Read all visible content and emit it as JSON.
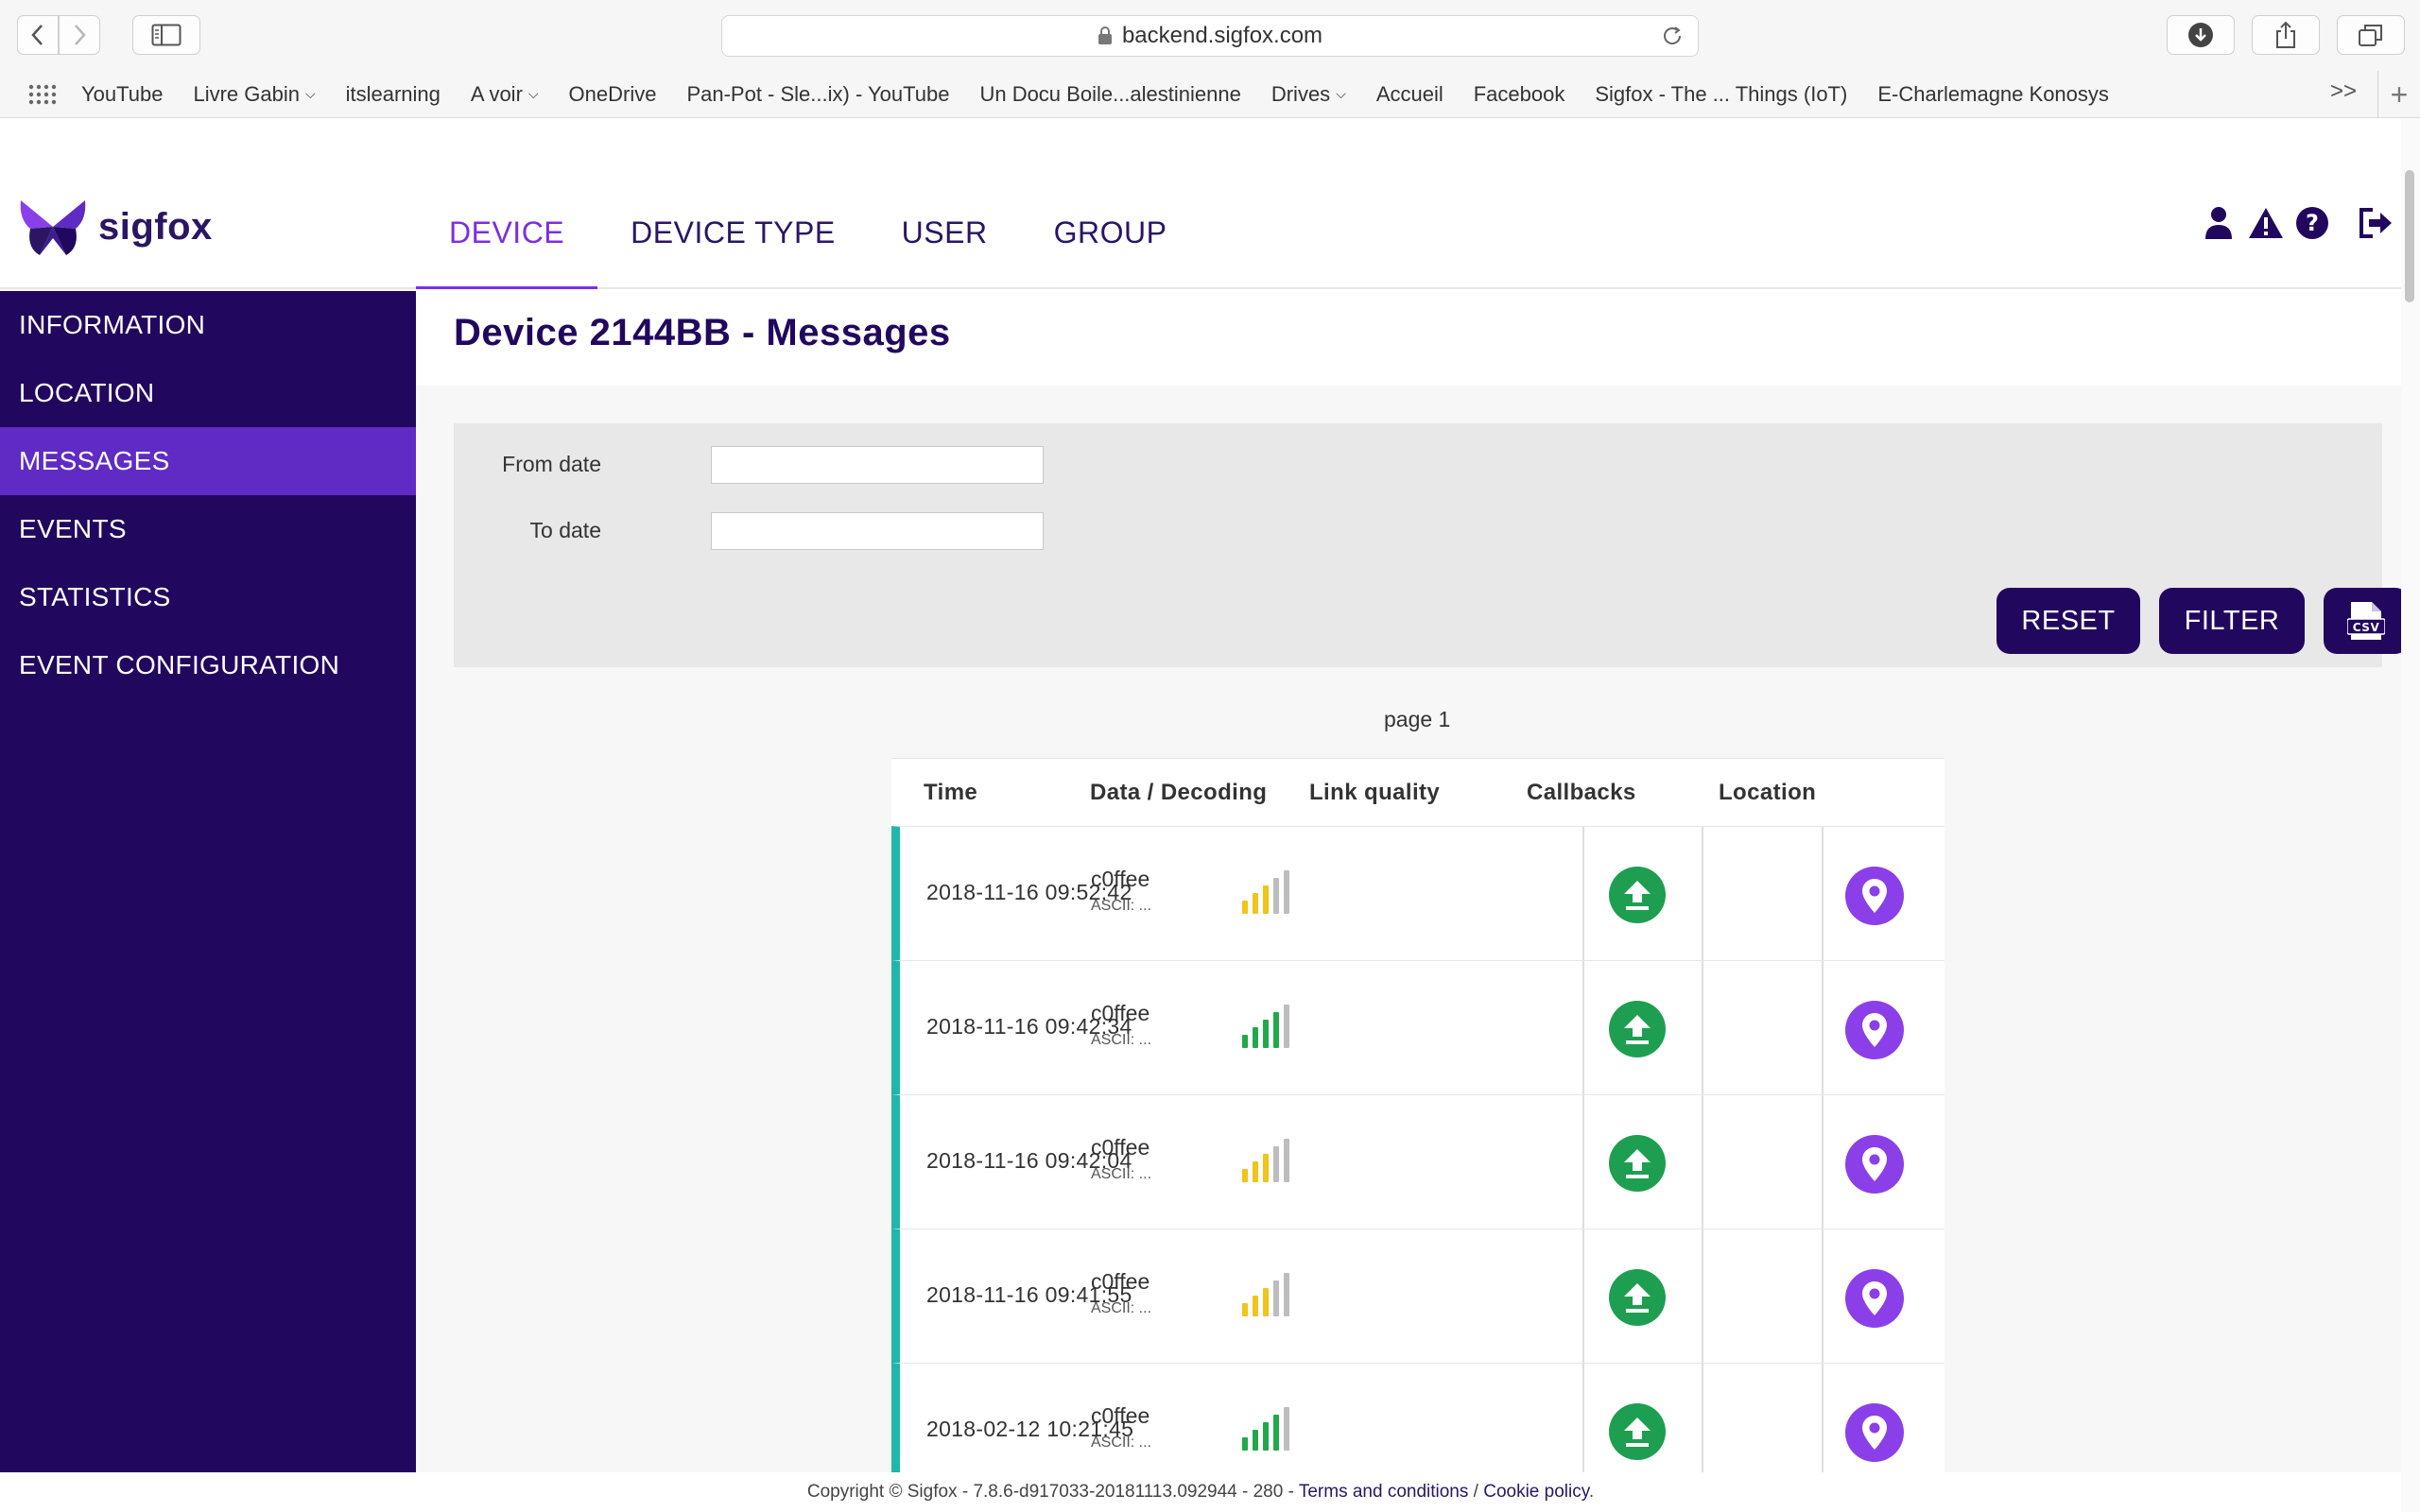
{
  "browser": {
    "url": "backend.sigfox.com",
    "bookmarks": [
      {
        "label": "YouTube",
        "dropdown": false
      },
      {
        "label": "Livre Gabin",
        "dropdown": true
      },
      {
        "label": "itslearning",
        "dropdown": false
      },
      {
        "label": "A voir",
        "dropdown": true
      },
      {
        "label": "OneDrive",
        "dropdown": false
      },
      {
        "label": "Pan-Pot - Sle...ix) - YouTube",
        "dropdown": false
      },
      {
        "label": "Un Docu Boile...alestinienne",
        "dropdown": false
      },
      {
        "label": "Drives",
        "dropdown": true
      },
      {
        "label": "Accueil",
        "dropdown": false
      },
      {
        "label": "Facebook",
        "dropdown": false
      },
      {
        "label": "Sigfox - The ... Things (IoT)",
        "dropdown": false
      },
      {
        "label": "E-Charlemagne Konosys",
        "dropdown": false
      }
    ],
    "more": ">>",
    "new_tab": "+"
  },
  "app": {
    "logo_text": "sigfox",
    "tabs": [
      "DEVICE",
      "DEVICE TYPE",
      "USER",
      "GROUP"
    ],
    "active_tab": "DEVICE",
    "header_icons": [
      "user-icon",
      "alert-icon",
      "help-icon",
      "logout-icon"
    ]
  },
  "sidebar": {
    "items": [
      "INFORMATION",
      "LOCATION",
      "MESSAGES",
      "EVENTS",
      "STATISTICS",
      "EVENT CONFIGURATION"
    ],
    "active": "MESSAGES"
  },
  "page": {
    "title": "Device 2144BB - Messages"
  },
  "filter": {
    "from_label": "From date",
    "to_label": "To date",
    "from_value": "",
    "to_value": "",
    "reset_label": "RESET",
    "filter_label": "FILTER",
    "csv_label": "CSV"
  },
  "pager": {
    "text": "page 1"
  },
  "table": {
    "headers": [
      "Time",
      "Data / Decoding",
      "Link quality",
      "Callbacks",
      "Location"
    ],
    "rows": [
      {
        "time": "2018-11-16 09:52:42",
        "data": "c0ffee",
        "ascii": "ASCII: ...",
        "link_bars": 3,
        "link_color": "#f0c419"
      },
      {
        "time": "2018-11-16 09:42:34",
        "data": "c0ffee",
        "ascii": "ASCII: ...",
        "link_bars": 4,
        "link_color": "#22a84a"
      },
      {
        "time": "2018-11-16 09:42:04",
        "data": "c0ffee",
        "ascii": "ASCII: ...",
        "link_bars": 3,
        "link_color": "#f0c419"
      },
      {
        "time": "2018-11-16 09:41:55",
        "data": "c0ffee",
        "ascii": "ASCII: ...",
        "link_bars": 3,
        "link_color": "#f0c419"
      },
      {
        "time": "2018-02-12 10:21:45",
        "data": "c0ffee",
        "ascii": "ASCII: ...",
        "link_bars": 4,
        "link_color": "#22a84a"
      }
    ]
  },
  "footer": {
    "copyright": "Copyright © Sigfox - 7.8.6-d917033-20181113.092944 - 280 - ",
    "terms": "Terms and conditions",
    "separator": " / ",
    "cookie": "Cookie policy",
    "end": "."
  },
  "colors": {
    "brand_dark": "#21085e",
    "brand_purple": "#7b2fe0",
    "sidebar_active": "#5f2bc4",
    "row_accent": "#1fb8a8",
    "callback_green": "#1e9e50",
    "location_purple": "#8b3fe8"
  }
}
